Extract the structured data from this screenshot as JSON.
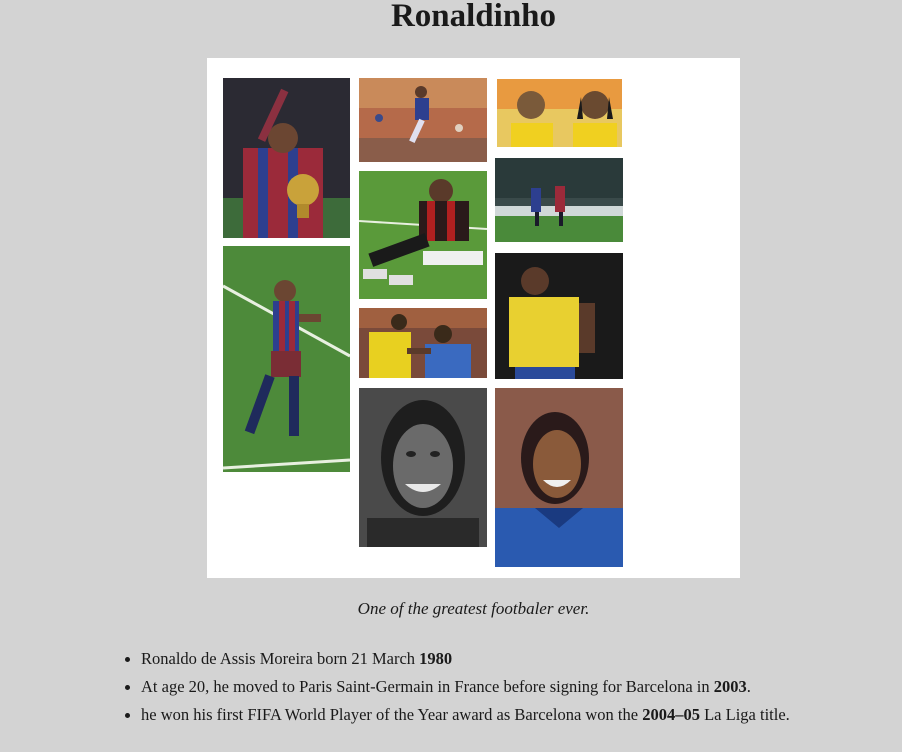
{
  "page": {
    "title": "Ronaldinho",
    "caption": "One of the greatest footbaler ever."
  },
  "gallery": {
    "photos": [
      {
        "name": "trophy-celebration-photo"
      },
      {
        "name": "stadium-jump-photo"
      },
      {
        "name": "brazil-duo-photo"
      },
      {
        "name": "barcelona-team-photo"
      },
      {
        "name": "milan-sitting-photo"
      },
      {
        "name": "fist-pump-photo"
      },
      {
        "name": "brazil-kit-portrait-photo"
      },
      {
        "name": "sideline-handshake-photo"
      },
      {
        "name": "monochrome-smile-portrait-photo"
      },
      {
        "name": "blue-jersey-smile-portrait-photo"
      }
    ]
  },
  "facts": [
    {
      "text": "Ronaldo de Assis Moreira born 21 March ",
      "bold": "1980",
      "after": ""
    },
    {
      "text": "At age 20, he moved to Paris Saint-Germain in France before signing for Barcelona in ",
      "bold": "2003",
      "after": "."
    },
    {
      "text": "he won his first FIFA World Player of the Year award as Barcelona won the ",
      "bold": "2004–05",
      "after": " La Liga title."
    }
  ]
}
